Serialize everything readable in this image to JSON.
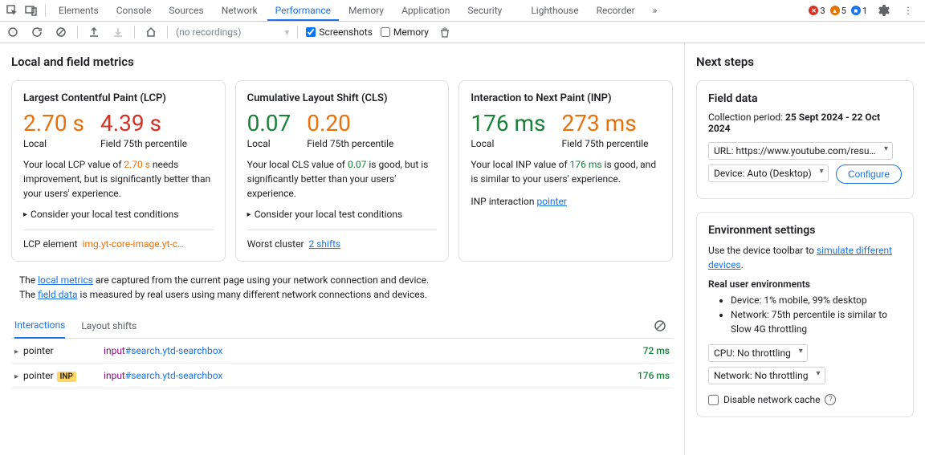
{
  "tabs": {
    "elements": "Elements",
    "console": "Console",
    "sources": "Sources",
    "network": "Network",
    "performance": "Performance",
    "memory": "Memory",
    "application": "Application",
    "security": "Security",
    "lighthouse": "Lighthouse",
    "recorder": "Recorder"
  },
  "badges": {
    "errors": "3",
    "warnings": "5",
    "issues": "1"
  },
  "toolbar": {
    "recordings": "(no recordings)",
    "screenshots": "Screenshots",
    "memory": "Memory"
  },
  "page_title": "Local and field metrics",
  "lcp": {
    "title": "Largest Contentful Paint (LCP)",
    "local_value": "2.70 s",
    "local_label": "Local",
    "field_value": "4.39 s",
    "field_label": "Field 75th percentile",
    "desc_pre": "Your local LCP value of ",
    "desc_val": "2.70 s",
    "desc_post": " needs improvement, but is significantly better than your users' experience.",
    "disclosure": "Consider your local test conditions",
    "footer_label": "LCP element",
    "footer_value": "img.yt-core-image.yt-c…"
  },
  "cls": {
    "title": "Cumulative Layout Shift (CLS)",
    "local_value": "0.07",
    "local_label": "Local",
    "field_value": "0.20",
    "field_label": "Field 75th percentile",
    "desc_pre": "Your local CLS value of ",
    "desc_val": "0.07",
    "desc_post": " is good, but is significantly better than your users' experience.",
    "disclosure": "Consider your local test conditions",
    "footer_label": "Worst cluster",
    "footer_value": "2 shifts"
  },
  "inp": {
    "title": "Interaction to Next Paint (INP)",
    "local_value": "176 ms",
    "local_label": "Local",
    "field_value": "273 ms",
    "field_label": "Field 75th percentile",
    "desc_pre": "Your local INP value of ",
    "desc_val": "176 ms",
    "desc_post": " is good, and is similar to your users' experience.",
    "footer_label": "INP interaction",
    "footer_value": "pointer"
  },
  "explain": {
    "l1_pre": "The ",
    "l1_link": "local metrics",
    "l1_post": " are captured from the current page using your network connection and device.",
    "l2_pre": "The ",
    "l2_link": "field data",
    "l2_post": " is measured by real users using many different network connections and devices."
  },
  "subtabs": {
    "interactions": "Interactions",
    "layout_shifts": "Layout shifts"
  },
  "rows": [
    {
      "name": "pointer",
      "inp_badge": "",
      "sel_tag": "input",
      "sel_id": "#search.ytd-searchbox",
      "time": "72 ms"
    },
    {
      "name": "pointer",
      "inp_badge": "INP",
      "sel_tag": "input",
      "sel_id": "#search.ytd-searchbox",
      "time": "176 ms"
    }
  ],
  "next_steps_title": "Next steps",
  "field_data": {
    "title": "Field data",
    "period_label": "Collection period: ",
    "period_value": "25 Sept 2024 - 22 Oct 2024",
    "url_select": "URL: https://www.youtube.com/results",
    "device_select": "Device: Auto (Desktop)",
    "configure": "Configure"
  },
  "env": {
    "title": "Environment settings",
    "desc_pre": "Use the device toolbar to ",
    "desc_link": "simulate different devices",
    "desc_post": ".",
    "real_label": "Real user environments",
    "bullet1": "Device: 1% mobile, 99% desktop",
    "bullet2": "Network: 75th percentile is similar to Slow 4G throttling",
    "cpu_select": "CPU: No throttling",
    "net_select": "Network: No throttling",
    "disable_cache": "Disable network cache"
  }
}
